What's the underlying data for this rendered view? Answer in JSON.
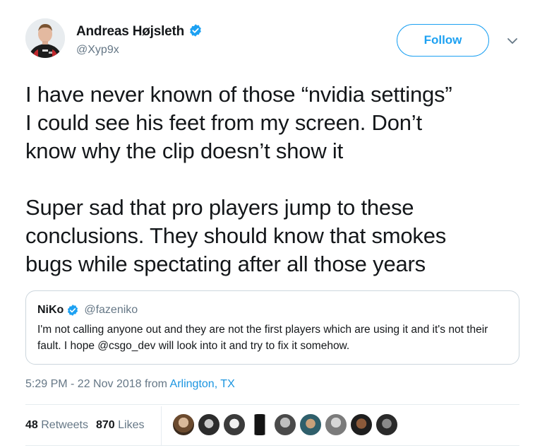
{
  "tweet": {
    "author": {
      "name": "Andreas Højsleth",
      "handle": "@Xyp9x",
      "verified": true
    },
    "follow_label": "Follow",
    "text_lines": [
      "I have never known of those “nvidia settings”",
      "I could see his feet from my screen. Don’t",
      "know why the clip doesn’t show it",
      "Super sad that pro players jump to these",
      "conclusions. They should know that smokes",
      "bugs while spectating after all those years"
    ],
    "quoted": {
      "name": "NiKo",
      "handle": "@fazeniko",
      "verified": true,
      "text": "I'm not calling anyone out and they are not the first players which are using it and it's not their fault. I hope @csgo_dev will look into it and try to fix it somehow."
    },
    "timestamp": "5:29 PM - 22 Nov 2018 from ",
    "location": "Arlington, TX",
    "stats": {
      "retweets_count": "48",
      "retweets_label": "Retweets",
      "likes_count": "870",
      "likes_label": "Likes"
    },
    "liker_count": 9
  },
  "colors": {
    "brand": "#1da1f2",
    "link": "#1b95e0",
    "text": "#14171a",
    "muted": "#657786",
    "border": "#ccd6dd"
  },
  "icons": {
    "verified": "verified-badge-icon",
    "chevron": "chevron-down-icon"
  }
}
